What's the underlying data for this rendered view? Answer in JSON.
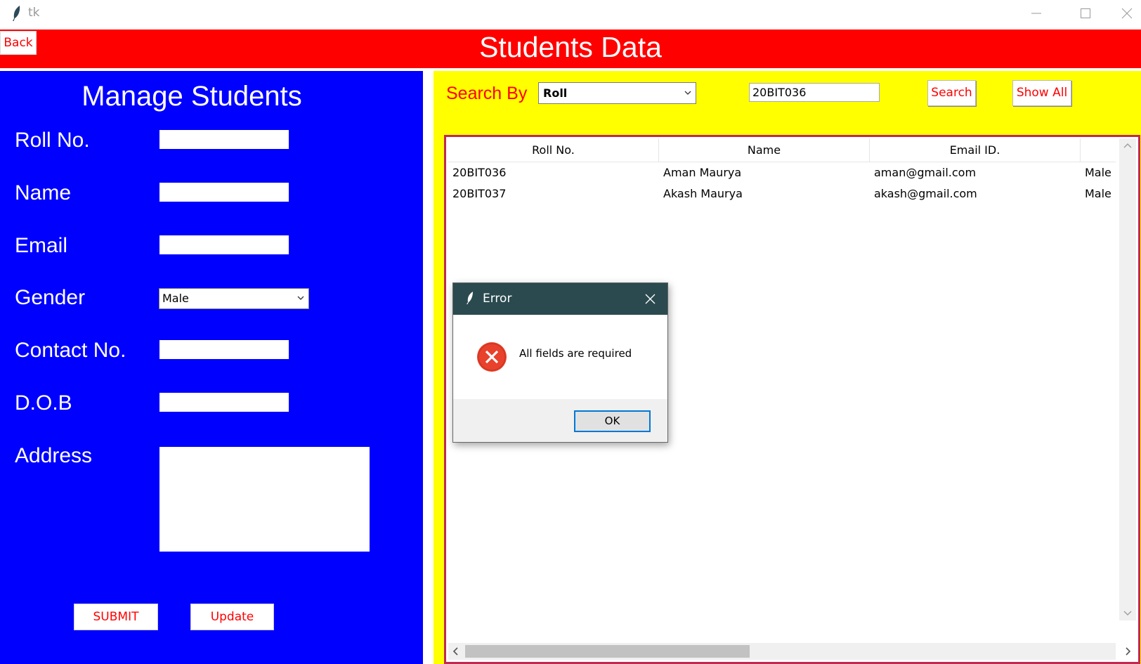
{
  "window": {
    "title": "tk"
  },
  "header": {
    "title": "Students Data",
    "back_label": "Back"
  },
  "manage": {
    "title": "Manage Students",
    "labels": {
      "roll": "Roll No.",
      "name": "Name",
      "email": "Email",
      "gender": "Gender",
      "contact": "Contact No.",
      "dob": "D.O.B",
      "address": "Address"
    },
    "gender_value": "Male",
    "submit_label": "SUBMIT",
    "update_label": "Update"
  },
  "search": {
    "label": "Search By",
    "by_value": "Roll",
    "query_value": "20BIT036",
    "search_label": "Search",
    "show_all_label": "Show All"
  },
  "table": {
    "columns": [
      "Roll No.",
      "Name",
      "Email ID.",
      ""
    ],
    "rows": [
      [
        "20BIT036",
        "Aman Maurya",
        "aman@gmail.com",
        "Male"
      ],
      [
        "20BIT037",
        "Akash Maurya",
        "akash@gmail.com",
        "Male"
      ]
    ]
  },
  "dialog": {
    "title": "Error",
    "message": "All fields are required",
    "ok_label": "OK"
  },
  "colors": {
    "header_bg": "#ff0000",
    "left_panel_bg": "#0000ff",
    "right_panel_bg": "#ffff00",
    "button_text": "#ff0000",
    "table_border": "#c0294f",
    "dialog_titlebar": "#2a4a4f",
    "error_icon": "#e8412c"
  },
  "icons": {
    "app": "feather-icon",
    "minimize": "minimize-icon",
    "maximize": "maximize-icon",
    "close": "close-icon",
    "dropdown": "chevron-down-icon",
    "error": "error-x-icon"
  }
}
